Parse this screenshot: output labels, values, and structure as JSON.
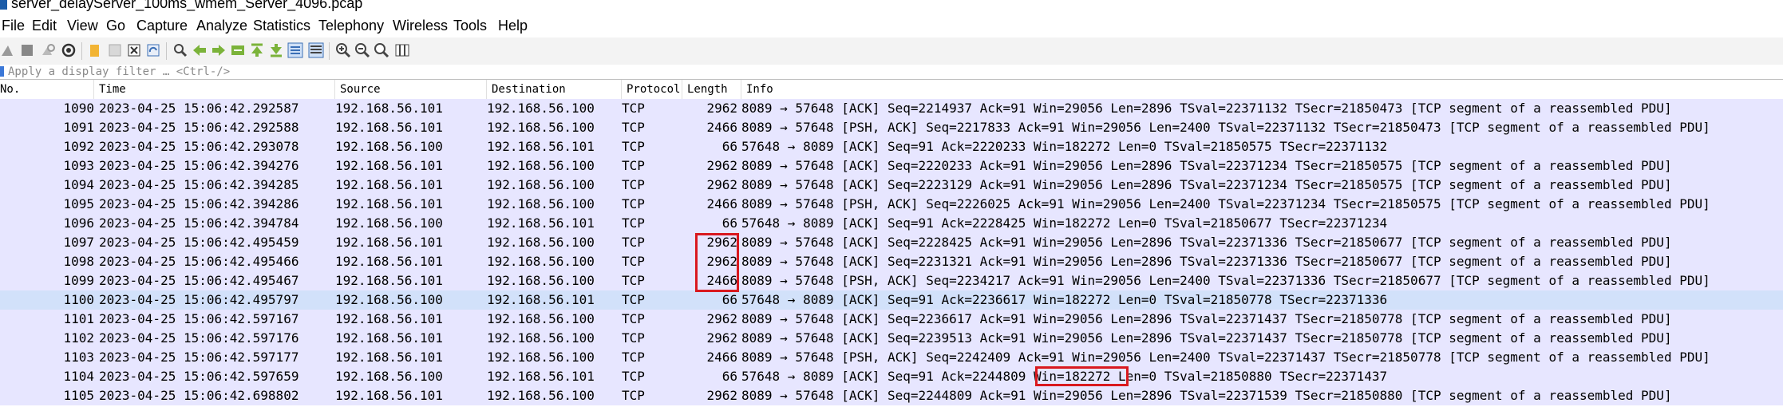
{
  "window": {
    "title": "server_delayServer_100ms_wmem_Server_4096.pcap"
  },
  "menu": [
    {
      "label": "File"
    },
    {
      "label": "Edit"
    },
    {
      "label": "View"
    },
    {
      "label": "Go"
    },
    {
      "label": "Capture"
    },
    {
      "label": "Analyze"
    },
    {
      "label": "Statistics"
    },
    {
      "label": "Telephony"
    },
    {
      "label": "Wireless"
    },
    {
      "label": "Tools"
    },
    {
      "label": "Help"
    }
  ],
  "toolbar": {
    "icons": [
      "shark-fin-start-icon",
      "stop-capture-icon",
      "restart-capture-icon",
      "capture-options-icon",
      "open-file-icon",
      "save-file-icon",
      "close-file-icon",
      "reload-file-icon",
      "find-packet-icon",
      "go-back-icon",
      "go-forward-icon",
      "go-to-packet-icon",
      "go-first-icon",
      "go-last-icon",
      "auto-scroll-icon",
      "colorize-icon",
      "zoom-in-icon",
      "zoom-out-icon",
      "zoom-normal-icon",
      "resize-columns-icon"
    ]
  },
  "filter": {
    "placeholder": "Apply a display filter … <Ctrl-/>",
    "value": ""
  },
  "columns": {
    "no": "No.",
    "time": "Time",
    "source": "Source",
    "destination": "Destination",
    "protocol": "Protocol",
    "length": "Length",
    "info": "Info"
  },
  "packets": [
    {
      "no": "1090",
      "time": "2023-04-25 15:06:42.292587",
      "source": "192.168.56.101",
      "destination": "192.168.56.100",
      "protocol": "TCP",
      "length": "2962",
      "info": "8089 → 57648 [ACK] Seq=2214937 Ack=91 Win=29056 Len=2896 TSval=22371132 TSecr=21850473 [TCP segment of a reassembled PDU]"
    },
    {
      "no": "1091",
      "time": "2023-04-25 15:06:42.292588",
      "source": "192.168.56.101",
      "destination": "192.168.56.100",
      "protocol": "TCP",
      "length": "2466",
      "info": "8089 → 57648 [PSH, ACK] Seq=2217833 Ack=91 Win=29056 Len=2400 TSval=22371132 TSecr=21850473 [TCP segment of a reassembled PDU]"
    },
    {
      "no": "1092",
      "time": "2023-04-25 15:06:42.293078",
      "source": "192.168.56.100",
      "destination": "192.168.56.101",
      "protocol": "TCP",
      "length": "66",
      "info": "57648 → 8089 [ACK] Seq=91 Ack=2220233 Win=182272 Len=0 TSval=21850575 TSecr=22371132"
    },
    {
      "no": "1093",
      "time": "2023-04-25 15:06:42.394276",
      "source": "192.168.56.101",
      "destination": "192.168.56.100",
      "protocol": "TCP",
      "length": "2962",
      "info": "8089 → 57648 [ACK] Seq=2220233 Ack=91 Win=29056 Len=2896 TSval=22371234 TSecr=21850575 [TCP segment of a reassembled PDU]"
    },
    {
      "no": "1094",
      "time": "2023-04-25 15:06:42.394285",
      "source": "192.168.56.101",
      "destination": "192.168.56.100",
      "protocol": "TCP",
      "length": "2962",
      "info": "8089 → 57648 [ACK] Seq=2223129 Ack=91 Win=29056 Len=2896 TSval=22371234 TSecr=21850575 [TCP segment of a reassembled PDU]"
    },
    {
      "no": "1095",
      "time": "2023-04-25 15:06:42.394286",
      "source": "192.168.56.101",
      "destination": "192.168.56.100",
      "protocol": "TCP",
      "length": "2466",
      "info": "8089 → 57648 [PSH, ACK] Seq=2226025 Ack=91 Win=29056 Len=2400 TSval=22371234 TSecr=21850575 [TCP segment of a reassembled PDU]"
    },
    {
      "no": "1096",
      "time": "2023-04-25 15:06:42.394784",
      "source": "192.168.56.100",
      "destination": "192.168.56.101",
      "protocol": "TCP",
      "length": "66",
      "info": "57648 → 8089 [ACK] Seq=91 Ack=2228425 Win=182272 Len=0 TSval=21850677 TSecr=22371234"
    },
    {
      "no": "1097",
      "time": "2023-04-25 15:06:42.495459",
      "source": "192.168.56.101",
      "destination": "192.168.56.100",
      "protocol": "TCP",
      "length": "2962",
      "info": "8089 → 57648 [ACK] Seq=2228425 Ack=91 Win=29056 Len=2896 TSval=22371336 TSecr=21850677 [TCP segment of a reassembled PDU]"
    },
    {
      "no": "1098",
      "time": "2023-04-25 15:06:42.495466",
      "source": "192.168.56.101",
      "destination": "192.168.56.100",
      "protocol": "TCP",
      "length": "2962",
      "info": "8089 → 57648 [ACK] Seq=2231321 Ack=91 Win=29056 Len=2896 TSval=22371336 TSecr=21850677 [TCP segment of a reassembled PDU]"
    },
    {
      "no": "1099",
      "time": "2023-04-25 15:06:42.495467",
      "source": "192.168.56.101",
      "destination": "192.168.56.100",
      "protocol": "TCP",
      "length": "2466",
      "info": "8089 → 57648 [PSH, ACK] Seq=2234217 Ack=91 Win=29056 Len=2400 TSval=22371336 TSecr=21850677 [TCP segment of a reassembled PDU]"
    },
    {
      "no": "1100",
      "time": "2023-04-25 15:06:42.495797",
      "source": "192.168.56.100",
      "destination": "192.168.56.101",
      "protocol": "TCP",
      "length": "66",
      "info": "57648 → 8089 [ACK] Seq=91 Ack=2236617 Win=182272 Len=0 TSval=21850778 TSecr=22371336",
      "selected": true
    },
    {
      "no": "1101",
      "time": "2023-04-25 15:06:42.597167",
      "source": "192.168.56.101",
      "destination": "192.168.56.100",
      "protocol": "TCP",
      "length": "2962",
      "info": "8089 → 57648 [ACK] Seq=2236617 Ack=91 Win=29056 Len=2896 TSval=22371437 TSecr=21850778 [TCP segment of a reassembled PDU]"
    },
    {
      "no": "1102",
      "time": "2023-04-25 15:06:42.597176",
      "source": "192.168.56.101",
      "destination": "192.168.56.100",
      "protocol": "TCP",
      "length": "2962",
      "info": "8089 → 57648 [ACK] Seq=2239513 Ack=91 Win=29056 Len=2896 TSval=22371437 TSecr=21850778 [TCP segment of a reassembled PDU]"
    },
    {
      "no": "1103",
      "time": "2023-04-25 15:06:42.597177",
      "source": "192.168.56.101",
      "destination": "192.168.56.100",
      "protocol": "TCP",
      "length": "2466",
      "info": "8089 → 57648 [PSH, ACK] Seq=2242409 Ack=91 Win=29056 Len=2400 TSval=22371437 TSecr=21850778 [TCP segment of a reassembled PDU]"
    },
    {
      "no": "1104",
      "time": "2023-04-25 15:06:42.597659",
      "source": "192.168.56.100",
      "destination": "192.168.56.101",
      "protocol": "TCP",
      "length": "66",
      "info": "57648 → 8089 [ACK] Seq=91 Ack=2244809 Win=182272 Len=0 TSval=21850880 TSecr=22371437"
    },
    {
      "no": "1105",
      "time": "2023-04-25 15:06:42.698802",
      "source": "192.168.56.101",
      "destination": "192.168.56.100",
      "protocol": "TCP",
      "length": "2962",
      "info": "8089 → 57648 [ACK] Seq=2244809 Ack=91 Win=29056 Len=2896 TSval=22371539 TSecr=21850880 [TCP segment of a reassembled PDU]"
    }
  ],
  "colors": {
    "row_bg": "#e7e6ff",
    "selected_row_bg": "#d2e1fa",
    "annotation": "#d9191f"
  }
}
